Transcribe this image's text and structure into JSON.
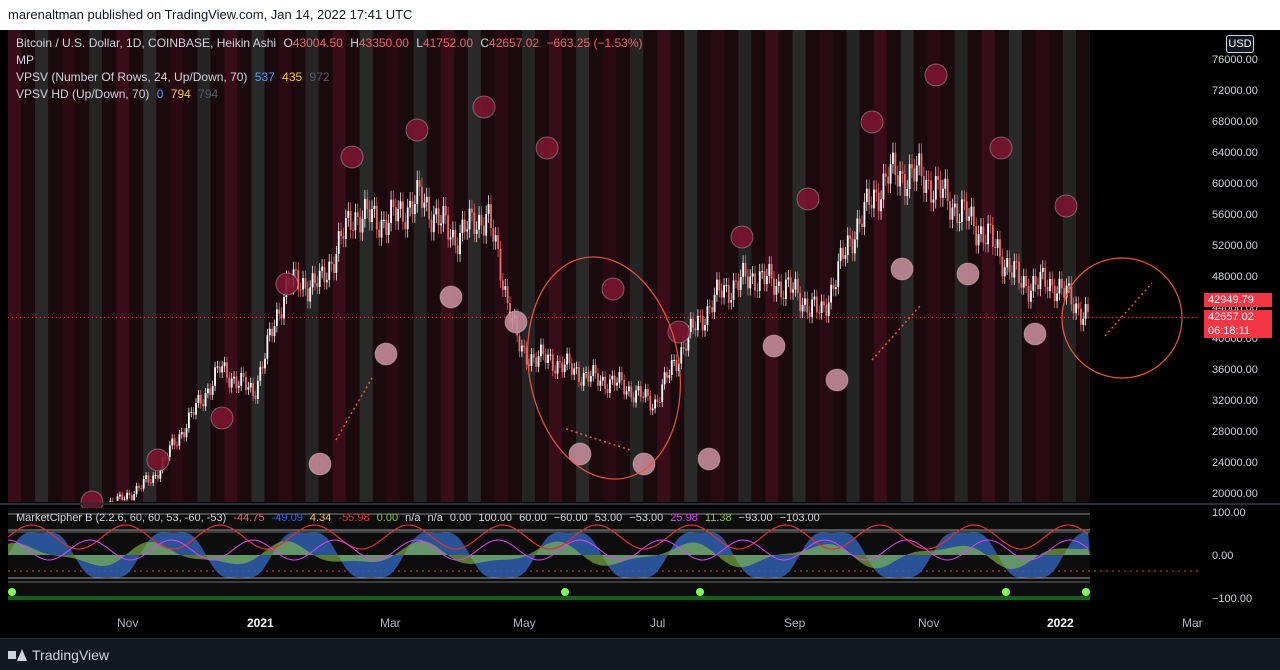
{
  "header": {
    "publisher_line": "marenaltman published on TradingView.com, Jan 14, 2022 17:41 UTC"
  },
  "legend": {
    "symbol": "Bitcoin / U.S. Dollar, 1D, COINBASE, Heikin Ashi",
    "o_label": "O",
    "o_value": "43004.50",
    "h_label": "H",
    "h_value": "43350.00",
    "l_label": "L",
    "l_value": "41752.00",
    "c_label": "C",
    "c_value": "42657.02",
    "change": "−663.25 (−1.53%)",
    "mp": "MP",
    "vpsv_name": "VPSV (Number Of Rows, 24, Up/Down, 70)",
    "vpsv_v1": "537",
    "vpsv_v2": "435",
    "vpsv_v3": "972",
    "vpsvhd_name": "VPSV HD (Up/Down, 70)",
    "vpsvhd_v1": "0",
    "vpsvhd_v2": "794",
    "vpsvhd_v3": "794"
  },
  "indicator": {
    "name": "MarketCipher B (2.2.6, 60, 60, 53, -60, -53)",
    "v1": "-44.75",
    "v2": "-49.09",
    "v3": "4.34",
    "v4": "-55.98",
    "v5": "0.00",
    "v6": "n/a",
    "v7": "n/a",
    "v8": "0.00",
    "v9": "100.00",
    "v10": "60.00",
    "v11": "−60.00",
    "v12": "53.00",
    "v13": "−53.00",
    "v14": "25.98",
    "v15": "11.38",
    "v16": "−93.00",
    "v17": "−103.00",
    "axis": [
      "100.00",
      "0.00",
      "−100.00"
    ]
  },
  "price_axis": {
    "currency": "USD",
    "ticks": [
      "76000.00",
      "72000.00",
      "68000.00",
      "64000.00",
      "60000.00",
      "56000.00",
      "52000.00",
      "48000.00",
      "44000.00",
      "40000.00",
      "36000.00",
      "32000.00",
      "28000.00",
      "24000.00",
      "20000.00"
    ],
    "label_top": "42949.79",
    "label_last": "42657.02",
    "label_countdown": "06:18:11"
  },
  "time_axis": {
    "labels": [
      "Nov",
      "2021",
      "Mar",
      "May",
      "Jul",
      "Sep",
      "Nov",
      "2022",
      "Mar"
    ]
  },
  "footer": {
    "brand": "TradingView"
  },
  "chart_data": {
    "type": "candlestick",
    "title": "Bitcoin / U.S. Dollar, 1D, COINBASE, Heikin Ashi",
    "ylim": [
      18000,
      78000
    ],
    "x": [
      "2020-10-22",
      "2020-11-05",
      "2020-11-19",
      "2020-12-03",
      "2020-12-17",
      "2020-12-31",
      "2021-01-14",
      "2021-01-28",
      "2021-02-11",
      "2021-02-25",
      "2021-03-11",
      "2021-03-25",
      "2021-04-08",
      "2021-04-22",
      "2021-05-06",
      "2021-05-20",
      "2021-06-03",
      "2021-06-17",
      "2021-07-01",
      "2021-07-15",
      "2021-07-29",
      "2021-08-12",
      "2021-08-26",
      "2021-09-09",
      "2021-09-23",
      "2021-10-07",
      "2021-10-21",
      "2021-11-04",
      "2021-11-18",
      "2021-12-02",
      "2021-12-16",
      "2021-12-30",
      "2022-01-13"
    ],
    "close": [
      13000,
      15500,
      18000,
      19000,
      22000,
      29000,
      36000,
      33000,
      47000,
      47000,
      56000,
      55000,
      58000,
      53000,
      56000,
      38000,
      37000,
      35000,
      34000,
      31500,
      40000,
      46000,
      48000,
      46500,
      43000,
      54000,
      61000,
      61000,
      57000,
      53000,
      47000,
      47000,
      42657
    ]
  }
}
